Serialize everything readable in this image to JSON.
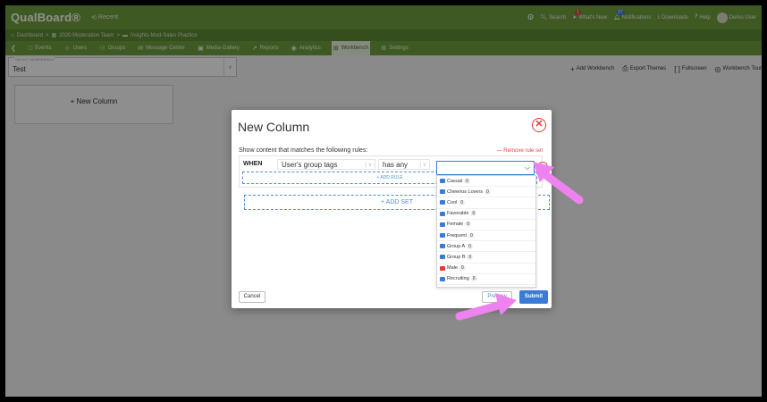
{
  "app": {
    "logo": "QualBoard®",
    "recent_label": "Recent"
  },
  "topbar": {
    "items": [
      {
        "label": "Search",
        "icon": "search-icon"
      },
      {
        "label": "What's New",
        "icon": "megaphone-icon",
        "badge": "1"
      },
      {
        "label": "Notifications",
        "icon": "bell-icon",
        "badge": "37"
      },
      {
        "label": "Downloads",
        "icon": "download-icon"
      },
      {
        "label": "Help",
        "icon": "help-icon"
      },
      {
        "label": "Demo User",
        "icon": "avatar"
      }
    ]
  },
  "breadcrumb": [
    "Dashboard",
    "2020 Moderation Team",
    "Insights-Mod-Sales Practice"
  ],
  "nav": {
    "items": [
      {
        "label": "Events",
        "icon": "calendar-icon"
      },
      {
        "label": "Users",
        "icon": "user-icon"
      },
      {
        "label": "Groups",
        "icon": "group-icon"
      },
      {
        "label": "Message Center",
        "icon": "envelope-icon"
      },
      {
        "label": "Media Gallery",
        "icon": "images-icon"
      },
      {
        "label": "Reports",
        "icon": "chart-icon"
      },
      {
        "label": "Analytics",
        "icon": "analytics-icon"
      },
      {
        "label": "Workbench",
        "icon": "grid-icon",
        "active": true
      },
      {
        "label": "Settings",
        "icon": "gear-icon"
      }
    ]
  },
  "workbench": {
    "select_label": "SELECT WORKBENCH",
    "select_value": "Test",
    "tools": [
      "Add Workbench",
      "Export Themes",
      "Fullscreen",
      "Workbench Tour"
    ],
    "new_column_label": "+ New Column"
  },
  "modal": {
    "title": "New Column",
    "rules_label": "Show content that matches the following rules:",
    "remove_rule_set": "— Remove rule set",
    "when": "WHEN",
    "field_select": "User's group tags",
    "operator_select": "has any",
    "add_rule": "+ ADD RULE",
    "add_set": "+ ADD SET",
    "cancel": "Cancel",
    "preview": "Preview",
    "submit": "Submit",
    "tag_options": [
      {
        "label": "Casual",
        "count": "0",
        "color": "#3a7bd5"
      },
      {
        "label": "Cheerios Lovers",
        "count": "0",
        "color": "#3a7bd5"
      },
      {
        "label": "Cool",
        "count": "0",
        "color": "#3a7bd5"
      },
      {
        "label": "Favorable",
        "count": "0",
        "color": "#3a7bd5"
      },
      {
        "label": "Female",
        "count": "0",
        "color": "#3a7bd5"
      },
      {
        "label": "Frequent",
        "count": "0",
        "color": "#3a7bd5"
      },
      {
        "label": "Group A",
        "count": "0",
        "color": "#3a7bd5"
      },
      {
        "label": "Group B",
        "count": "0",
        "color": "#3a7bd5"
      },
      {
        "label": "Male",
        "count": "0",
        "color": "#e03c3c"
      },
      {
        "label": "Recruiting",
        "count": "0",
        "color": "#3a7bd5"
      }
    ]
  },
  "colors": {
    "brand_green": "#6f9d3e",
    "accent_blue": "#3a7bd5",
    "danger_red": "#e03c3c",
    "annotation_pink": "#ee82ee"
  }
}
